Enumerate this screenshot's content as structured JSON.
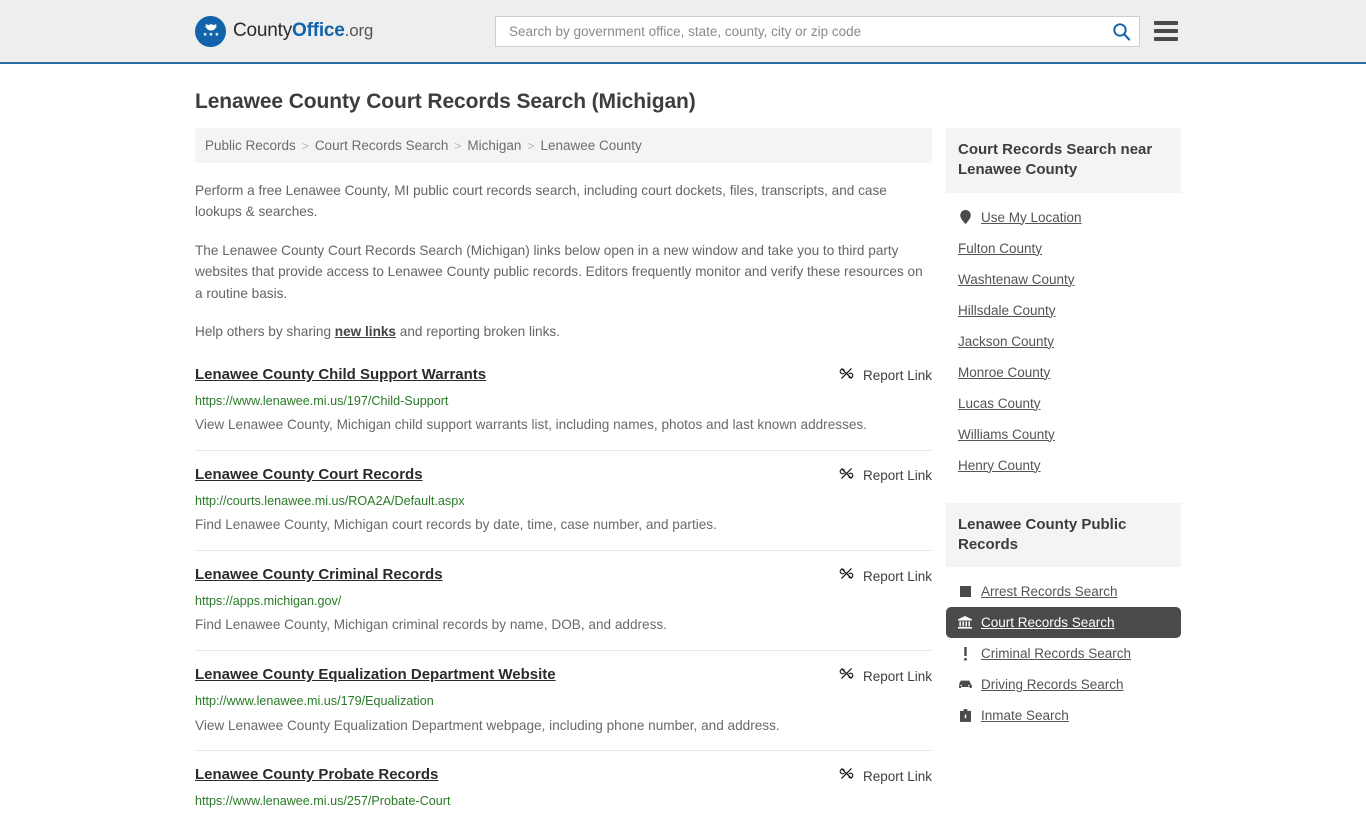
{
  "header": {
    "logo": {
      "icon": "eagle-badge-icon",
      "text_part1": "County",
      "text_part2": "Office",
      "text_part3": ".org"
    },
    "search": {
      "placeholder": "Search by government office, state, county, city or zip code",
      "value": "",
      "icon": "search-icon"
    },
    "menu_icon": "hamburger-menu-icon"
  },
  "page": {
    "title": "Lenawee County Court Records Search (Michigan)"
  },
  "breadcrumb": {
    "items": [
      {
        "label": "Public Records"
      },
      {
        "label": "Court Records Search"
      },
      {
        "label": "Michigan"
      },
      {
        "label": "Lenawee County"
      }
    ],
    "separator": ">"
  },
  "intro": {
    "p1": "Perform a free Lenawee County, MI public court records search, including court dockets, files, transcripts, and case lookups & searches.",
    "p2": "The Lenawee County Court Records Search (Michigan) links below open in a new window and take you to third party websites that provide access to Lenawee County public records. Editors frequently monitor and verify these resources on a routine basis.",
    "p3_before": "Help others by sharing ",
    "p3_link": "new links",
    "p3_after": " and reporting broken links."
  },
  "report_link": {
    "label": "Report Link",
    "icon": "broken-link-icon"
  },
  "results": [
    {
      "title": "Lenawee County Child Support Warrants",
      "url": "https://www.lenawee.mi.us/197/Child-Support",
      "description": "View Lenawee County, Michigan child support warrants list, including names, photos and last known addresses."
    },
    {
      "title": "Lenawee County Court Records",
      "url": "http://courts.lenawee.mi.us/ROA2A/Default.aspx",
      "description": "Find Lenawee County, Michigan court records by date, time, case number, and parties."
    },
    {
      "title": "Lenawee County Criminal Records",
      "url": "https://apps.michigan.gov/",
      "description": "Find Lenawee County, Michigan criminal records by name, DOB, and address."
    },
    {
      "title": "Lenawee County Equalization Department Website",
      "url": "http://www.lenawee.mi.us/179/Equalization",
      "description": "View Lenawee County Equalization Department webpage, including phone number, and address."
    },
    {
      "title": "Lenawee County Probate Records",
      "url": "https://www.lenawee.mi.us/257/Probate-Court",
      "description": ""
    }
  ],
  "sidebar": {
    "nearby": {
      "heading": "Court Records Search near Lenawee County",
      "items": [
        {
          "label": "Use My Location",
          "icon": "map-pin-icon"
        },
        {
          "label": "Fulton County",
          "icon": ""
        },
        {
          "label": "Washtenaw County",
          "icon": ""
        },
        {
          "label": "Hillsdale County",
          "icon": ""
        },
        {
          "label": "Jackson County",
          "icon": ""
        },
        {
          "label": "Monroe County",
          "icon": ""
        },
        {
          "label": "Lucas County",
          "icon": ""
        },
        {
          "label": "Williams County",
          "icon": ""
        },
        {
          "label": "Henry County",
          "icon": ""
        }
      ]
    },
    "public_records": {
      "heading": "Lenawee County Public Records",
      "items": [
        {
          "label": "Arrest Records Search",
          "icon": "square-icon",
          "active": false
        },
        {
          "label": "Court Records Search",
          "icon": "courthouse-icon",
          "active": true
        },
        {
          "label": "Criminal Records Search",
          "icon": "exclamation-icon",
          "active": false
        },
        {
          "label": "Driving Records Search",
          "icon": "car-icon",
          "active": false
        },
        {
          "label": "Inmate Search",
          "icon": "inmate-icon",
          "active": false
        }
      ]
    }
  },
  "colors": {
    "header_bg": "#eeeeee",
    "header_border": "#2d6ca2",
    "brand_blue": "#1163ab",
    "url_green": "#2a7a27",
    "active_bg": "#4a4a4a",
    "panel_bg": "#f4f4f4"
  }
}
